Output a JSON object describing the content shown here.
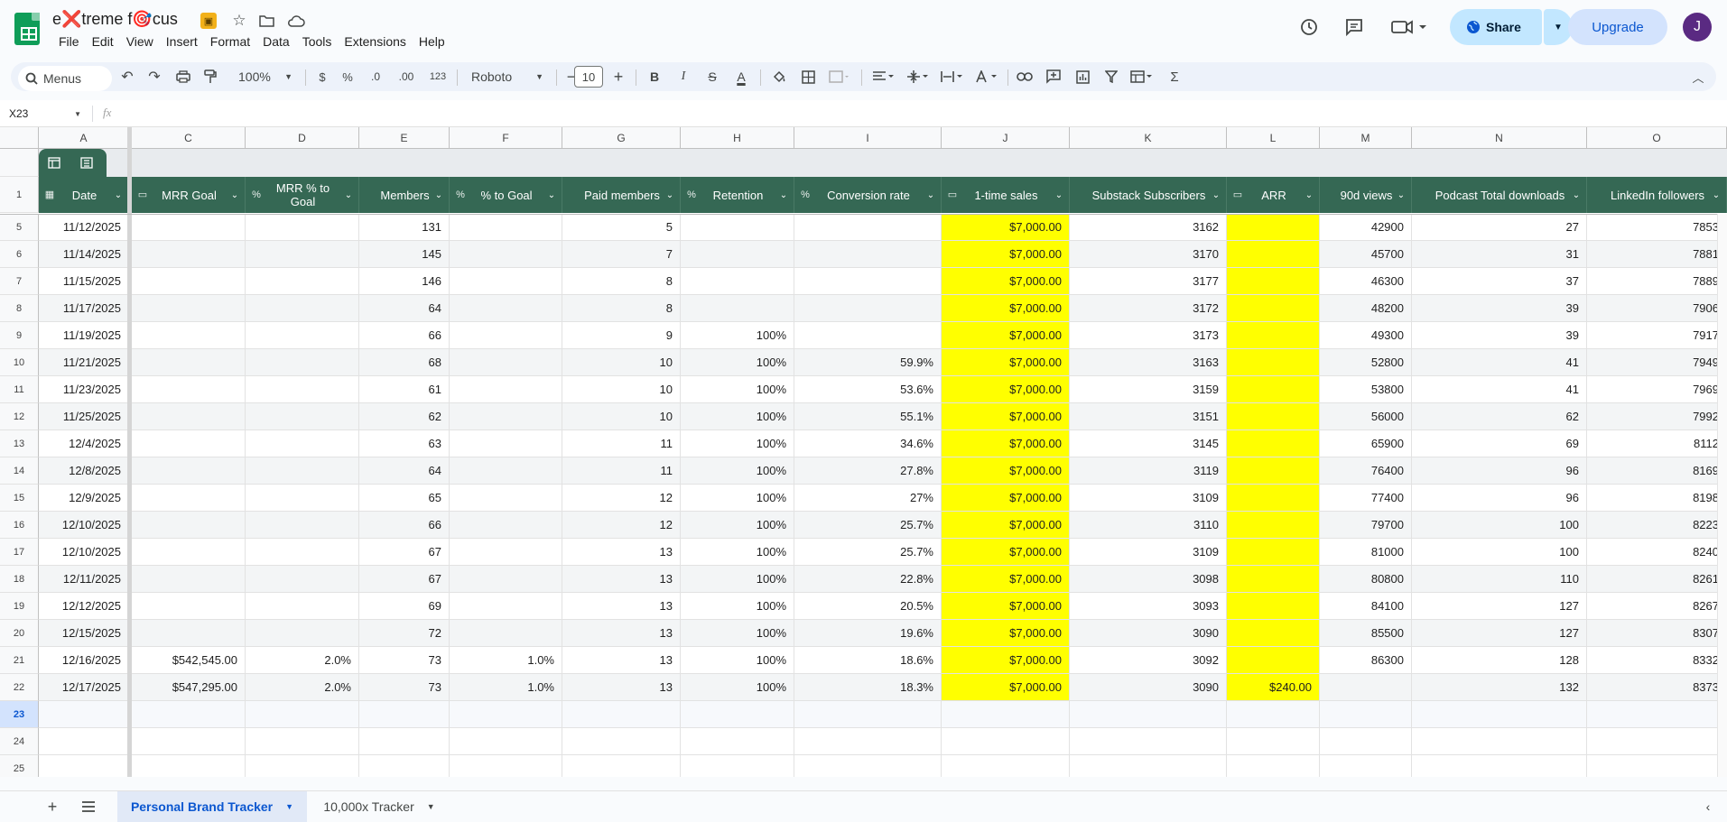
{
  "app": {
    "title": "e❌treme f🎯cus",
    "menu": [
      "File",
      "Edit",
      "View",
      "Insert",
      "Format",
      "Data",
      "Tools",
      "Extensions",
      "Help"
    ],
    "share_label": "Share",
    "upgrade_label": "Upgrade",
    "avatar_initial": "J",
    "accent_share": "#c2e7ff",
    "accent_upgrade": "#d3e3fd",
    "avatar_color": "#5a2a82"
  },
  "toolbar": {
    "search_label": "Menus",
    "zoom": "100%",
    "currency": "$",
    "percent": "%",
    "dec_dec": ".0",
    "dec_inc": ".00",
    "format_123": "123",
    "font": "Roboto",
    "font_size": "10",
    "bold": "B",
    "italic": "I",
    "strike": "S",
    "text_color": "A",
    "sigma": "Σ"
  },
  "formula": {
    "cell_ref": "X23",
    "fx": "fx"
  },
  "columns": [
    "A",
    "C",
    "D",
    "E",
    "F",
    "G",
    "H",
    "I",
    "J",
    "K",
    "L",
    "M",
    "N",
    "O"
  ],
  "headers": [
    {
      "label": "Date",
      "icon": "calendar-icon",
      "icon_char": "▦"
    },
    {
      "label": "MRR Goal",
      "icon": "currency-icon",
      "icon_char": "▭"
    },
    {
      "label": "MRR % to Goal",
      "icon": "percent-icon",
      "icon_char": "%"
    },
    {
      "label": "Members",
      "icon": "",
      "icon_char": ""
    },
    {
      "label": "% to Goal",
      "icon": "percent-icon",
      "icon_char": "%"
    },
    {
      "label": "Paid members",
      "icon": "",
      "icon_char": ""
    },
    {
      "label": "Retention",
      "icon": "percent-icon",
      "icon_char": "%"
    },
    {
      "label": "Conversion rate",
      "icon": "percent-icon",
      "icon_char": "%"
    },
    {
      "label": "1-time sales",
      "icon": "currency-icon",
      "icon_char": "▭"
    },
    {
      "label": "Substack Subscribers",
      "icon": "",
      "icon_char": ""
    },
    {
      "label": "ARR",
      "icon": "currency-icon",
      "icon_char": "▭"
    },
    {
      "label": "90d views",
      "icon": "",
      "icon_char": ""
    },
    {
      "label": "Podcast Total downloads",
      "icon": "",
      "icon_char": ""
    },
    {
      "label": "LinkedIn followers",
      "icon": "",
      "icon_char": ""
    }
  ],
  "row_numbers": [
    "1",
    "5",
    "6",
    "7",
    "8",
    "9",
    "10",
    "11",
    "12",
    "13",
    "14",
    "15",
    "16",
    "17",
    "18",
    "19",
    "20",
    "21",
    "22",
    "23",
    "24",
    "25"
  ],
  "rows": [
    [
      "11/12/2025",
      "",
      "",
      "131",
      "",
      "5",
      "",
      "",
      "$7,000.00",
      "3162",
      "",
      "42900",
      "27",
      "7853"
    ],
    [
      "11/14/2025",
      "",
      "",
      "145",
      "",
      "7",
      "",
      "",
      "$7,000.00",
      "3170",
      "",
      "45700",
      "31",
      "7881"
    ],
    [
      "11/15/2025",
      "",
      "",
      "146",
      "",
      "8",
      "",
      "",
      "$7,000.00",
      "3177",
      "",
      "46300",
      "37",
      "7889"
    ],
    [
      "11/17/2025",
      "",
      "",
      "64",
      "",
      "8",
      "",
      "",
      "$7,000.00",
      "3172",
      "",
      "48200",
      "39",
      "7906"
    ],
    [
      "11/19/2025",
      "",
      "",
      "66",
      "",
      "9",
      "100%",
      "",
      "$7,000.00",
      "3173",
      "",
      "49300",
      "39",
      "7917"
    ],
    [
      "11/21/2025",
      "",
      "",
      "68",
      "",
      "10",
      "100%",
      "59.9%",
      "$7,000.00",
      "3163",
      "",
      "52800",
      "41",
      "7949"
    ],
    [
      "11/23/2025",
      "",
      "",
      "61",
      "",
      "10",
      "100%",
      "53.6%",
      "$7,000.00",
      "3159",
      "",
      "53800",
      "41",
      "7969"
    ],
    [
      "11/25/2025",
      "",
      "",
      "62",
      "",
      "10",
      "100%",
      "55.1%",
      "$7,000.00",
      "3151",
      "",
      "56000",
      "62",
      "7992"
    ],
    [
      "12/4/2025",
      "",
      "",
      "63",
      "",
      "11",
      "100%",
      "34.6%",
      "$7,000.00",
      "3145",
      "",
      "65900",
      "69",
      "8112"
    ],
    [
      "12/8/2025",
      "",
      "",
      "64",
      "",
      "11",
      "100%",
      "27.8%",
      "$7,000.00",
      "3119",
      "",
      "76400",
      "96",
      "8169"
    ],
    [
      "12/9/2025",
      "",
      "",
      "65",
      "",
      "12",
      "100%",
      "27%",
      "$7,000.00",
      "3109",
      "",
      "77400",
      "96",
      "8198"
    ],
    [
      "12/10/2025",
      "",
      "",
      "66",
      "",
      "12",
      "100%",
      "25.7%",
      "$7,000.00",
      "3110",
      "",
      "79700",
      "100",
      "8223"
    ],
    [
      "12/10/2025",
      "",
      "",
      "67",
      "",
      "13",
      "100%",
      "25.7%",
      "$7,000.00",
      "3109",
      "",
      "81000",
      "100",
      "8240"
    ],
    [
      "12/11/2025",
      "",
      "",
      "67",
      "",
      "13",
      "100%",
      "22.8%",
      "$7,000.00",
      "3098",
      "",
      "80800",
      "110",
      "8261"
    ],
    [
      "12/12/2025",
      "",
      "",
      "69",
      "",
      "13",
      "100%",
      "20.5%",
      "$7,000.00",
      "3093",
      "",
      "84100",
      "127",
      "8267"
    ],
    [
      "12/15/2025",
      "",
      "",
      "72",
      "",
      "13",
      "100%",
      "19.6%",
      "$7,000.00",
      "3090",
      "",
      "85500",
      "127",
      "8307"
    ],
    [
      "12/16/2025",
      "$542,545.00",
      "2.0%",
      "73",
      "1.0%",
      "13",
      "100%",
      "18.6%",
      "$7,000.00",
      "3092",
      "",
      "86300",
      "128",
      "8332"
    ],
    [
      "12/17/2025",
      "$547,295.00",
      "2.0%",
      "73",
      "1.0%",
      "13",
      "100%",
      "18.3%",
      "$7,000.00",
      "3090",
      "$240.00",
      "",
      "132",
      "8373"
    ]
  ],
  "colors": {
    "header_green": "#356854",
    "highlight_yellow": "#ffff00",
    "band_gray": "#f3f3f3"
  },
  "sheet_tabs": [
    {
      "label": "Personal Brand Tracker",
      "active": true
    },
    {
      "label": "10,000x Tracker",
      "active": false
    }
  ]
}
